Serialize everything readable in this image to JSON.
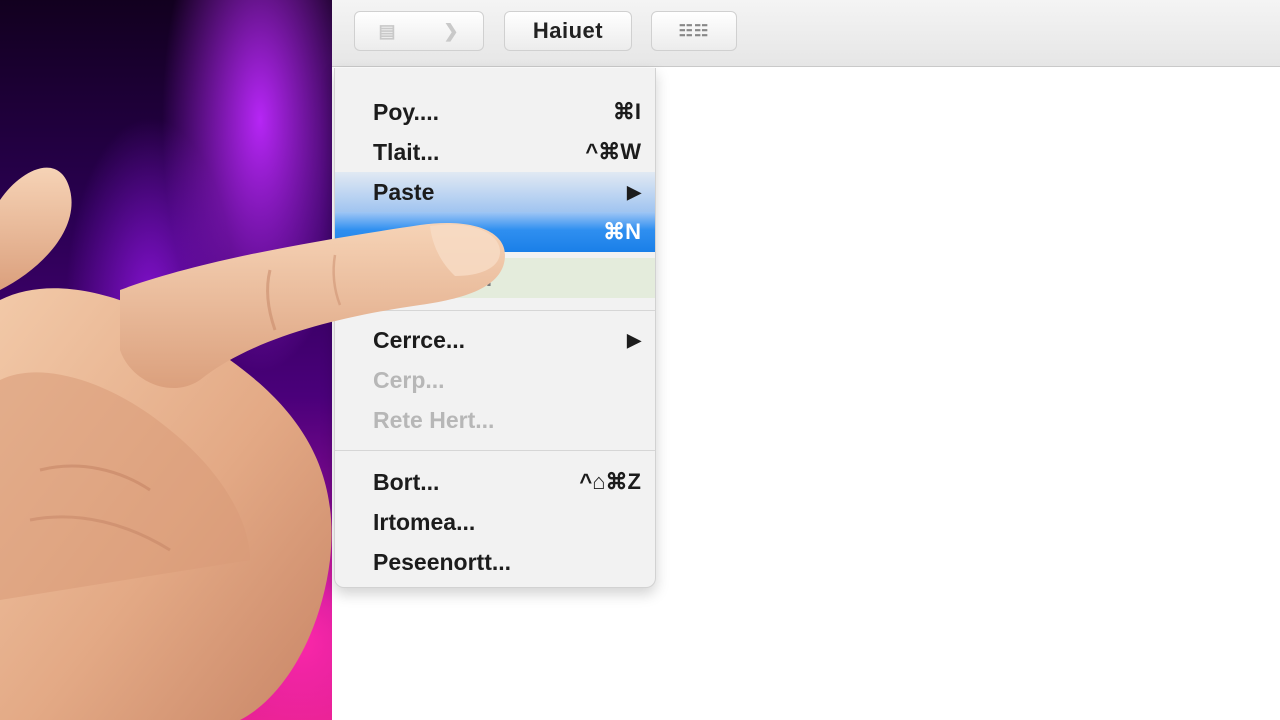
{
  "toolbar": {
    "back_icon": "back-arrow-icon",
    "forward_icon": "forward-arrow-icon",
    "title": "Haiuet",
    "view_icon": "grid-view-icon"
  },
  "menu": {
    "items": [
      {
        "label": "Poy....",
        "shortcut": "⌘I",
        "state": "normal"
      },
      {
        "label": "Tlait...",
        "shortcut": "^⌘W",
        "state": "normal"
      },
      {
        "label": "Paste",
        "shortcut": "▶",
        "state": "normal"
      },
      {
        "label": "",
        "shortcut": "⌘N",
        "state": "highlighted"
      },
      {
        "label": "...",
        "shortcut": "",
        "state": "normal"
      },
      {
        "label": "Cerrce...",
        "shortcut": "▶",
        "state": "normal"
      },
      {
        "label": "Cerp...",
        "shortcut": "",
        "state": "disabled"
      },
      {
        "label": "Rete Hert...",
        "shortcut": "",
        "state": "disabled"
      },
      {
        "label": "Bort...",
        "shortcut": "^⌂⌘Z",
        "state": "normal"
      },
      {
        "label": "Irtomea...",
        "shortcut": "",
        "state": "normal"
      },
      {
        "label": "Peseenortt...",
        "shortcut": "",
        "state": "normal"
      }
    ]
  },
  "colors": {
    "highlight": "#1a7fe8",
    "backdrop_top": "#12001f",
    "backdrop_bottom": "#e0208c"
  }
}
